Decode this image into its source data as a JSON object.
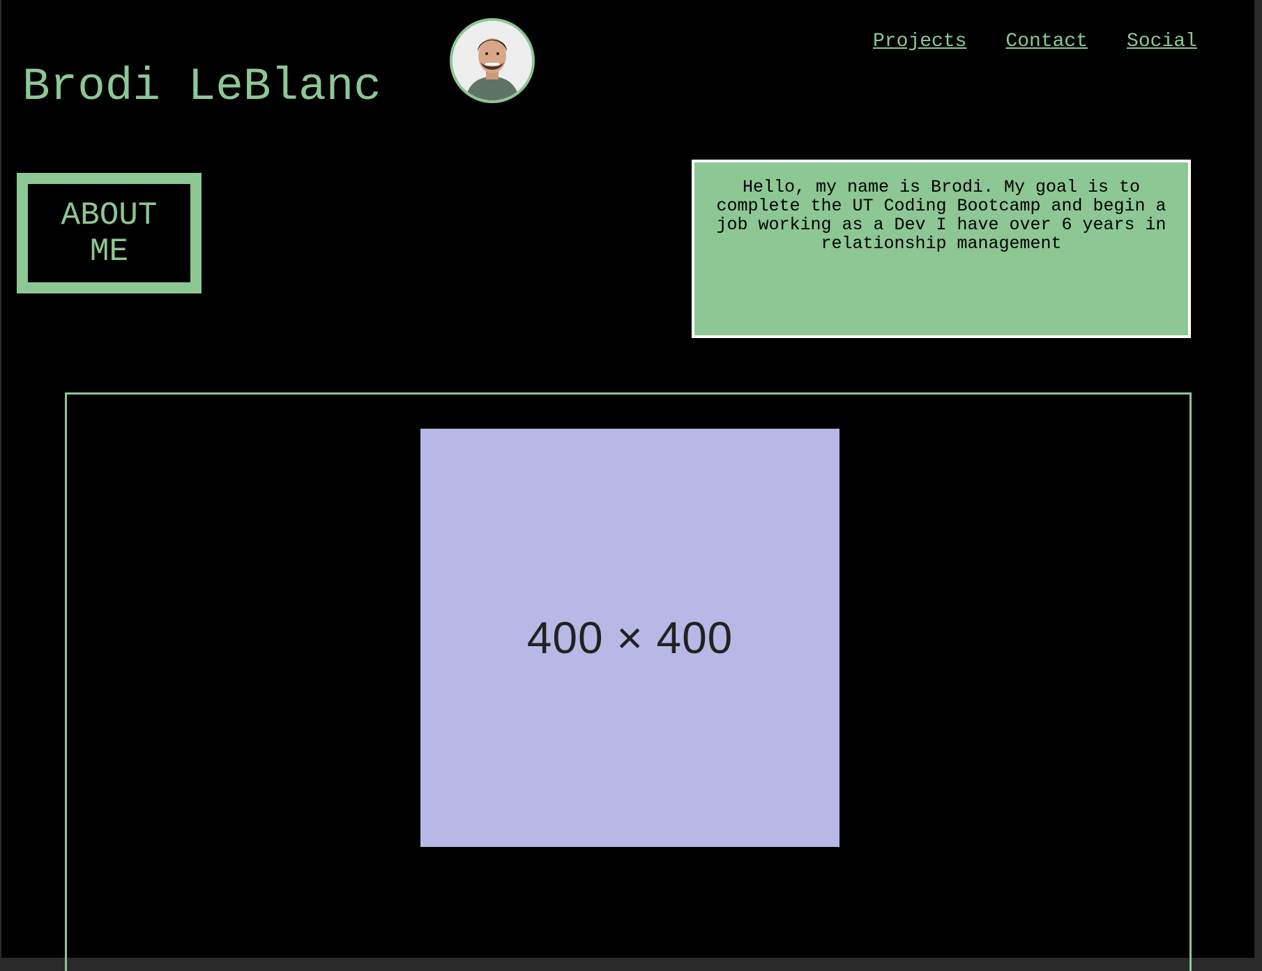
{
  "header": {
    "name": "Brodi LeBlanc",
    "avatar_alt": "profile photo of Brodi"
  },
  "nav": {
    "items": [
      {
        "label": "Projects"
      },
      {
        "label": "Contact"
      },
      {
        "label": "Social"
      }
    ]
  },
  "about": {
    "title": "ABOUT ME",
    "text": "Hello, my name is Brodi. My goal is to complete the UT Coding Bootcamp and begin a job working as a Dev I have over 6 years in relationship management"
  },
  "projects": {
    "placeholder_label": "400 × 400"
  },
  "colors": {
    "accent": "#8dc794",
    "background": "#000000",
    "placeholder": "#b8b8e6"
  }
}
